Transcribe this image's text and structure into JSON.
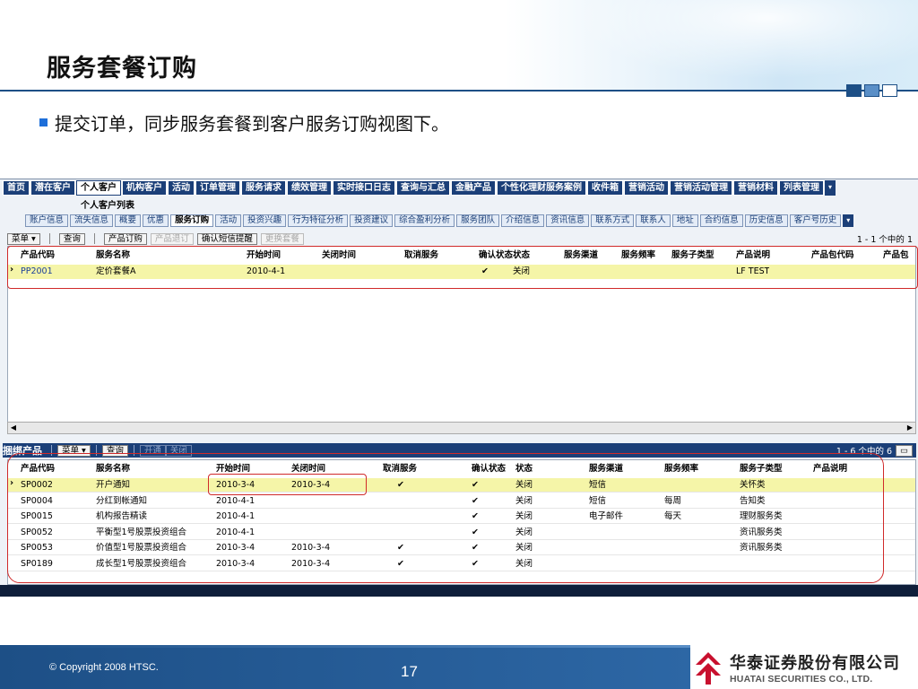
{
  "slide": {
    "title": "服务套餐订购",
    "bullet": "提交订单，同步服务套餐到客户服务订购视图下。",
    "copyright": "© Copyright 2008 HTSC.",
    "page_number": "17",
    "logo_cn": "华泰证券股份有限公司",
    "logo_en": "HUATAI SECURITIES CO., LTD."
  },
  "app": {
    "main_tabs": [
      "首页",
      "潜在客户",
      "个人客户",
      "机构客户",
      "活动",
      "订单管理",
      "服务请求",
      "绩效管理",
      "实时接口日志",
      "查询与汇总",
      "金融产品",
      "个性化理财服务案例",
      "收件箱",
      "营销活动",
      "营销活动管理",
      "营销材料",
      "列表管理"
    ],
    "active_main_tab": "个人客户",
    "subheading": "个人客户列表",
    "sub_tabs": [
      "账户信息",
      "流失信息",
      "概要",
      "优惠",
      "服务订购",
      "活动",
      "投资兴趣",
      "行为特征分析",
      "投资建议",
      "综合盈利分析",
      "服务团队",
      "介绍信息",
      "资讯信息",
      "联系方式",
      "联系人",
      "地址",
      "合约信息",
      "历史信息",
      "客户号历史"
    ],
    "active_sub_tab": "服务订购",
    "toolbar": {
      "menu": "菜单",
      "query": "查询",
      "product_order": "产品订购",
      "product_unsubscribe": "产品退订",
      "confirm_sms": "确认短信提醒",
      "change_package": "更换套餐",
      "pager": "1 - 1 个中的 1"
    },
    "grid1": {
      "headers": [
        "产品代码",
        "服务名称",
        "开始时间",
        "关闭时间",
        "取消服务",
        "确认状态",
        "状态",
        "服务渠道",
        "服务频率",
        "服务子类型",
        "产品说明",
        "产品包代码",
        "产品包"
      ],
      "rows": [
        {
          "code": "PP2001",
          "name": "定价套餐A",
          "start": "2010-4-1",
          "end": "",
          "cancel": "",
          "confirm": "✔",
          "status": "关闭",
          "channel": "",
          "freq": "",
          "subtype": "",
          "desc": "LF TEST",
          "pkg_code": "",
          "pkg": ""
        }
      ]
    },
    "bundle": {
      "title": "捆绑产品",
      "menu": "菜单",
      "query": "查询",
      "open": "开通",
      "close": "关闭",
      "pager": "1 - 6 个中的 6",
      "headers": [
        "产品代码",
        "服务名称",
        "开始时间",
        "关闭时间",
        "取消服务",
        "确认状态",
        "状态",
        "服务渠道",
        "服务频率",
        "服务子类型",
        "产品说明"
      ],
      "rows": [
        {
          "code": "SP0002",
          "name": "开户通知",
          "start": "2010-3-4",
          "end": "2010-3-4",
          "cancel": "✔",
          "confirm": "✔",
          "status": "关闭",
          "channel": "短信",
          "freq": "",
          "subtype": "关怀类",
          "desc": ""
        },
        {
          "code": "SP0004",
          "name": "分红到帐通知",
          "start": "2010-4-1",
          "end": "",
          "cancel": "",
          "confirm": "✔",
          "status": "关闭",
          "channel": "短信",
          "freq": "每周",
          "subtype": "告知类",
          "desc": ""
        },
        {
          "code": "SP0015",
          "name": "机构报告精读",
          "start": "2010-4-1",
          "end": "",
          "cancel": "",
          "confirm": "✔",
          "status": "关闭",
          "channel": "电子邮件",
          "freq": "每天",
          "subtype": "理财服务类",
          "desc": ""
        },
        {
          "code": "SP0052",
          "name": "平衡型1号股票投资组合",
          "start": "2010-4-1",
          "end": "",
          "cancel": "",
          "confirm": "✔",
          "status": "关闭",
          "channel": "",
          "freq": "",
          "subtype": "资讯服务类",
          "desc": ""
        },
        {
          "code": "SP0053",
          "name": "价值型1号股票投资组合",
          "start": "2010-3-4",
          "end": "2010-3-4",
          "cancel": "✔",
          "confirm": "✔",
          "status": "关闭",
          "channel": "",
          "freq": "",
          "subtype": "资讯服务类",
          "desc": ""
        },
        {
          "code": "SP0189",
          "name": "成长型1号股票投资组合",
          "start": "2010-3-4",
          "end": "2010-3-4",
          "cancel": "✔",
          "confirm": "✔",
          "status": "关闭",
          "channel": "",
          "freq": "",
          "subtype": "",
          "desc": ""
        }
      ]
    }
  },
  "colors": {
    "nav_dark": "#1b3f78",
    "title_rule": "#1d4f86",
    "highlight_red": "#d02a2a",
    "selected_row": "#f5f5a8"
  },
  "chart_data": {
    "type": "table",
    "title": "",
    "columns": [
      "产品代码",
      "服务名称",
      "开始时间",
      "关闭时间",
      "取消服务",
      "确认状态",
      "状态",
      "服务渠道",
      "服务频率",
      "服务子类型"
    ],
    "rows": [
      [
        "SP0002",
        "开户通知",
        "2010-3-4",
        "2010-3-4",
        "✔",
        "✔",
        "关闭",
        "短信",
        "",
        "关怀类"
      ],
      [
        "SP0004",
        "分红到帐通知",
        "2010-4-1",
        "",
        "",
        "✔",
        "关闭",
        "短信",
        "每周",
        "告知类"
      ],
      [
        "SP0015",
        "机构报告精读",
        "2010-4-1",
        "",
        "",
        "✔",
        "关闭",
        "电子邮件",
        "每天",
        "理财服务类"
      ],
      [
        "SP0052",
        "平衡型1号股票投资组合",
        "2010-4-1",
        "",
        "",
        "✔",
        "关闭",
        "",
        "",
        "资讯服务类"
      ],
      [
        "SP0053",
        "价值型1号股票投资组合",
        "2010-3-4",
        "2010-3-4",
        "✔",
        "✔",
        "关闭",
        "",
        "",
        "资讯服务类"
      ],
      [
        "SP0189",
        "成长型1号股票投资组合",
        "2010-3-4",
        "2010-3-4",
        "✔",
        "✔",
        "关闭",
        "",
        "",
        ""
      ]
    ]
  }
}
